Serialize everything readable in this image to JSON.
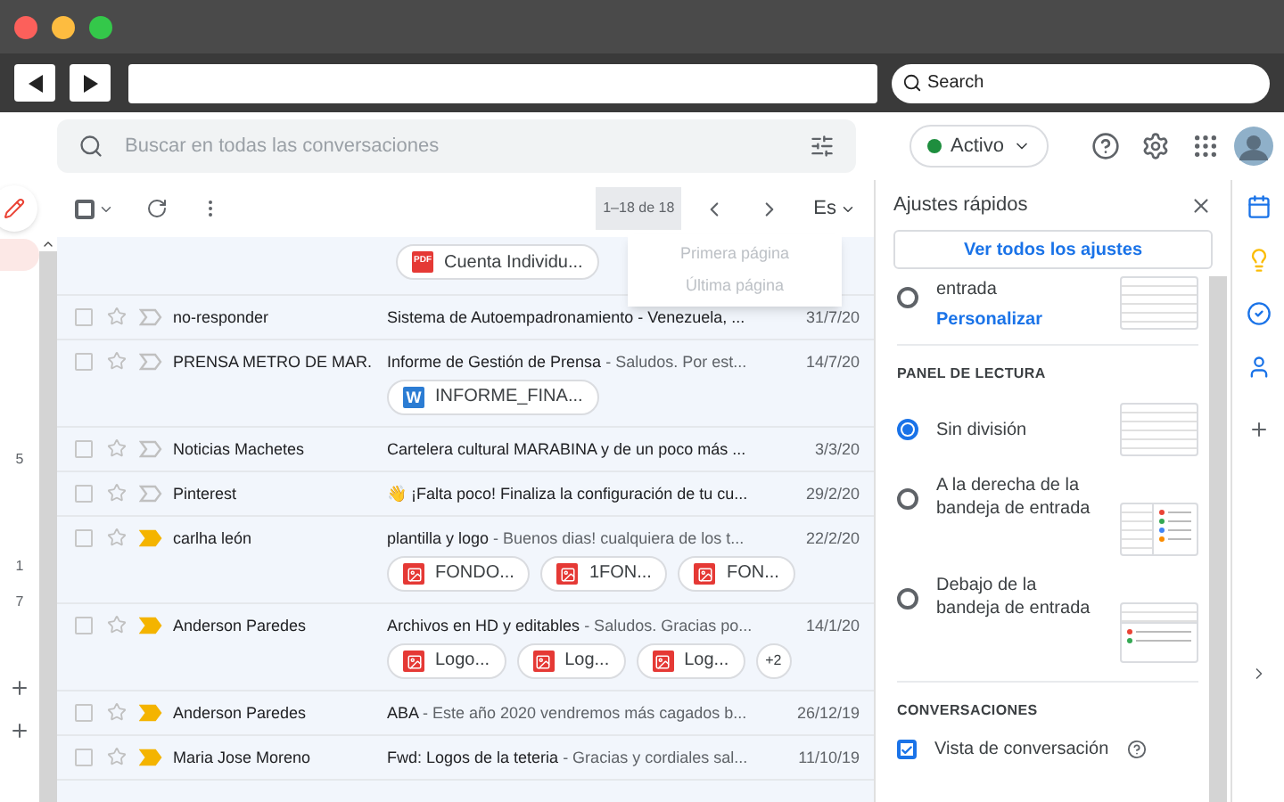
{
  "browser": {
    "search_placeholder": "Search"
  },
  "search": {
    "placeholder": "Buscar en todas las conversaciones"
  },
  "status": {
    "label": "Activo",
    "color": "#1e8e3e"
  },
  "toolbar": {
    "select_all_checked": false,
    "pager": "1–18 de 18",
    "lang": "Es"
  },
  "pager_menu": [
    {
      "label": "Primera página",
      "disabled": true
    },
    {
      "label": "Última página",
      "disabled": true
    }
  ],
  "left_rail": {
    "counts": [
      "5",
      "1",
      "7"
    ]
  },
  "rows": [
    {
      "kind": "attachments_only",
      "attachments": [
        {
          "kind": "pdf",
          "icon": "PDF",
          "label": "Cuenta Individu..."
        }
      ]
    },
    {
      "kind": "mail",
      "checked": false,
      "sender": "no-responder",
      "subject": "Sistema de Autoempadronamiento - Venezuela, ...",
      "snippet": "",
      "date": "31/7/20",
      "important": false,
      "attachments": []
    },
    {
      "kind": "mail",
      "checked": false,
      "sender": "PRENSA METRO DE MAR.",
      "subject": "Informe de Gestión de Prensa",
      "snippet": " - Saludos. Por est...",
      "date": "14/7/20",
      "important": false,
      "attachments": [
        {
          "kind": "word",
          "icon": "W",
          "label": "INFORME_FINA..."
        }
      ]
    },
    {
      "kind": "mail",
      "checked": false,
      "sender": "Noticias Machetes",
      "subject": "Cartelera cultural MARABINA y de un poco más ...",
      "snippet": "",
      "date": "3/3/20",
      "important": false,
      "attachments": []
    },
    {
      "kind": "mail",
      "checked": false,
      "sender": "Pinterest",
      "subject": "👋 ¡Falta poco! Finaliza la configuración de tu cu...",
      "snippet": "",
      "date": "29/2/20",
      "important": false,
      "attachments": []
    },
    {
      "kind": "mail",
      "checked": false,
      "sender": "carlha león",
      "subject": "plantilla y logo",
      "snippet": " - Buenos dias! cualquiera de los t...",
      "date": "22/2/20",
      "important": true,
      "attachments": [
        {
          "kind": "image",
          "label": "FONDO..."
        },
        {
          "kind": "image",
          "label": "1FON..."
        },
        {
          "kind": "image",
          "label": "FON..."
        }
      ]
    },
    {
      "kind": "mail",
      "checked": false,
      "sender": "Anderson Paredes",
      "subject": "Archivos en HD y editables",
      "snippet": " - Saludos. Gracias po...",
      "date": "14/1/20",
      "important": true,
      "attachments": [
        {
          "kind": "image",
          "label": "Logo..."
        },
        {
          "kind": "image",
          "label": "Log..."
        },
        {
          "kind": "image",
          "label": "Log..."
        }
      ],
      "more": "+2"
    },
    {
      "kind": "mail",
      "checked": false,
      "sender": "Anderson Paredes",
      "subject": "ABA",
      "snippet": " - Este año 2020 vendremos más cagados b...",
      "date": "26/12/19",
      "important": true,
      "attachments": []
    },
    {
      "kind": "mail",
      "checked": false,
      "sender": "Maria Jose Moreno",
      "subject": "Fwd: Logos de la teteria",
      "snippet": " - Gracias y cordiales sal...",
      "date": "11/10/19",
      "important": true,
      "attachments": []
    }
  ],
  "quick_settings": {
    "title": "Ajustes rápidos",
    "all_settings": "Ver todos los ajustes",
    "top_option": {
      "label": "entrada",
      "link": "Personalizar",
      "selected": false
    },
    "reading_title": "PANEL DE LECTURA",
    "reading_options": [
      {
        "label": "Sin división",
        "selected": true,
        "kind": "none"
      },
      {
        "label": "A la derecha de la bandeja de entrada",
        "selected": false,
        "kind": "right"
      },
      {
        "label": "Debajo de la bandeja de entrada",
        "selected": false,
        "kind": "below"
      }
    ],
    "conv_title": "CONVERSACIONES",
    "conv_option": {
      "label": "Vista de conversación",
      "checked": true
    }
  }
}
